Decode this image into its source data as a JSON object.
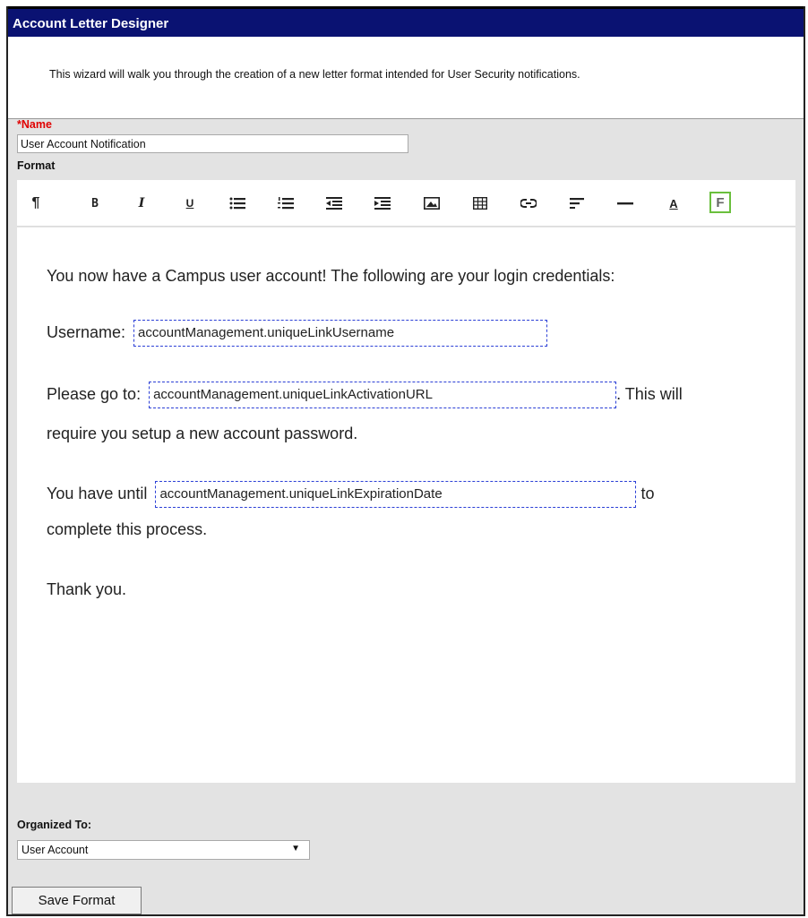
{
  "header": {
    "title": "Account Letter Designer"
  },
  "intro": {
    "text": "This wizard will walk you through the creation of a new letter format intended for User Security notifications."
  },
  "name_field": {
    "required_marker": "*",
    "label": "Name",
    "value": "User Account Notification"
  },
  "format": {
    "label": "Format"
  },
  "toolbar": {
    "buttons": [
      {
        "name": "paragraph-icon",
        "glyph": "¶"
      },
      {
        "name": "bold-icon",
        "glyph": "B"
      },
      {
        "name": "italic-icon",
        "glyph": "I"
      },
      {
        "name": "underline-icon",
        "glyph": "U"
      },
      {
        "name": "bullet-list-icon"
      },
      {
        "name": "numbered-list-icon"
      },
      {
        "name": "outdent-icon"
      },
      {
        "name": "indent-icon"
      },
      {
        "name": "image-icon"
      },
      {
        "name": "table-icon"
      },
      {
        "name": "link-icon"
      },
      {
        "name": "align-left-icon"
      },
      {
        "name": "horizontal-rule-icon"
      },
      {
        "name": "font-color-icon",
        "glyph": "A"
      },
      {
        "name": "field-insert-icon",
        "glyph": "F"
      }
    ]
  },
  "editor": {
    "line1": "You now have a Campus user account! The following are your login credentials:",
    "username_label": "Username:",
    "username_field": "accountManagement.uniqueLinkUsername",
    "goto_label": "Please go to:",
    "activation_field": "accountManagement.uniqueLinkActivationURL",
    "goto_suffix": ". This will",
    "goto_line2": "require you setup a new account password.",
    "until_label": "You have until",
    "expiration_field": "accountManagement.uniqueLinkExpirationDate",
    "until_suffix": "to",
    "until_line2": "complete this process.",
    "thanks": "Thank you."
  },
  "organized_to": {
    "label": "Organized To:",
    "selected": "User Account"
  },
  "save_button": {
    "label": "Save Format"
  },
  "colors": {
    "header_bg": "#0a1272",
    "required": "#e00000",
    "field_border": "#2b3fd6",
    "field_insert_border": "#6abf3d"
  }
}
